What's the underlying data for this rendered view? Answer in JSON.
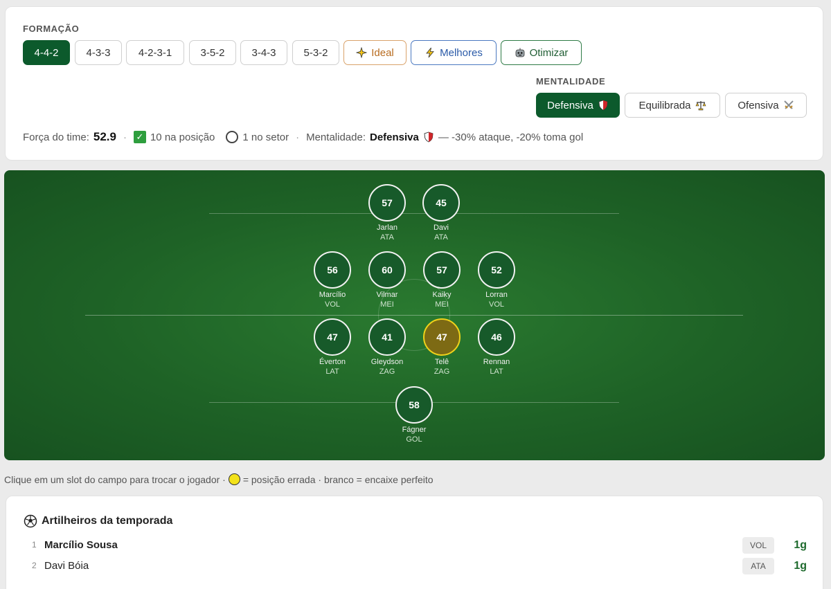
{
  "formation": {
    "label": "FORMAÇÃO",
    "options": [
      "4-4-2",
      "4-3-3",
      "4-2-3-1",
      "3-5-2",
      "3-4-3",
      "5-3-2"
    ],
    "active": "4-4-2",
    "ideal_label": "Ideal",
    "melhores_label": "Melhores",
    "otimizar_label": "Otimizar"
  },
  "mentality": {
    "label": "MENTALIDADE",
    "options": [
      "Defensiva",
      "Equilibrada",
      "Ofensiva"
    ],
    "active": "Defensiva"
  },
  "summary": {
    "strength_label": "Força do time:",
    "strength_value": "52.9",
    "in_position": "10 na posição",
    "in_sector": "1 no setor",
    "mentality_label": "Mentalidade:",
    "mentality_value": "Defensiva",
    "mentality_effect": "— -30% ataque, -20% toma gol"
  },
  "players": [
    {
      "rating": "57",
      "name": "Jarlan",
      "pos": "ATA",
      "wrong": false
    },
    {
      "rating": "45",
      "name": "Davi",
      "pos": "ATA",
      "wrong": false
    },
    {
      "rating": "56",
      "name": "Marcílio",
      "pos": "VOL",
      "wrong": false
    },
    {
      "rating": "60",
      "name": "Vilmar",
      "pos": "MEI",
      "wrong": false
    },
    {
      "rating": "57",
      "name": "Kaiky",
      "pos": "MEI",
      "wrong": false
    },
    {
      "rating": "52",
      "name": "Lorran",
      "pos": "VOL",
      "wrong": false
    },
    {
      "rating": "47",
      "name": "Éverton",
      "pos": "LAT",
      "wrong": false
    },
    {
      "rating": "41",
      "name": "Gleydson",
      "pos": "ZAG",
      "wrong": false
    },
    {
      "rating": "47",
      "name": "Telê",
      "pos": "ZAG",
      "wrong": true
    },
    {
      "rating": "46",
      "name": "Rennan",
      "pos": "LAT",
      "wrong": false
    },
    {
      "rating": "58",
      "name": "Fágner",
      "pos": "GOL",
      "wrong": false
    }
  ],
  "hint": {
    "part1": "Clique em um slot do campo para trocar o jogador ·",
    "part2": "= posição errada · branco = encaixe perfeito"
  },
  "scorers": {
    "title": "Artilheiros da temporada",
    "rows": [
      {
        "rank": "1",
        "name": "Marcílio Sousa",
        "pos": "VOL",
        "goals": "1g"
      },
      {
        "rank": "2",
        "name": "Davi Bóia",
        "pos": "ATA",
        "goals": "1g"
      }
    ]
  },
  "colors": {
    "accent": "#0c5a2c",
    "wrong_position": "#f0d21a",
    "goals": "#1e6a2d"
  }
}
